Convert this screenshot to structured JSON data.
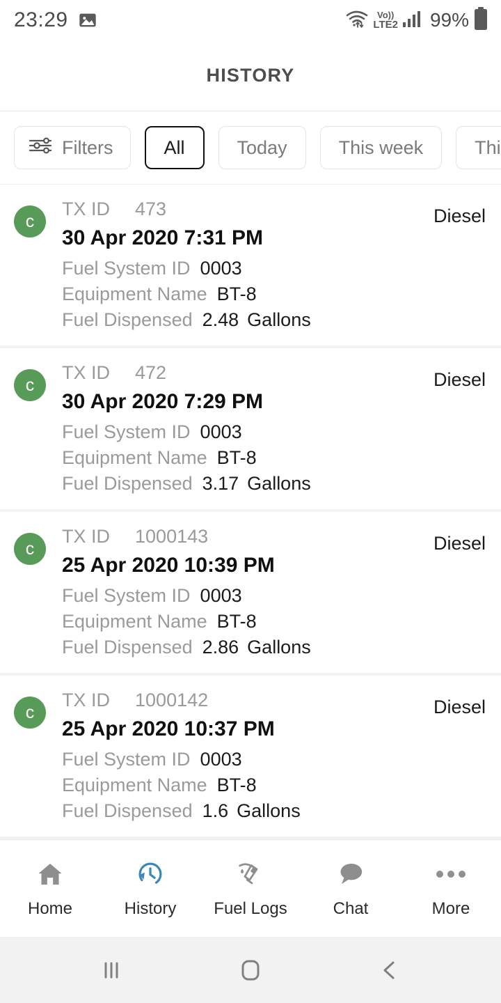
{
  "status_bar": {
    "clock": "23:29",
    "left_icon": "image-icon",
    "network_label_top": "Vo))",
    "network_label": "LTE2",
    "battery_percent": "99%",
    "icons": [
      "image-icon",
      "wifi-icon",
      "volte-icon",
      "signal-icon",
      "battery-icon"
    ]
  },
  "header": {
    "title": "HISTORY"
  },
  "filters": {
    "filters_label": "Filters",
    "filter_icon": "sliders-icon",
    "chips": [
      {
        "label": "All",
        "selected": true
      },
      {
        "label": "Today",
        "selected": false
      },
      {
        "label": "This week",
        "selected": false
      },
      {
        "label": "This month",
        "selected": false
      }
    ]
  },
  "labels": {
    "tx_id": "TX ID",
    "fuel_system_id": "Fuel System ID",
    "equipment_name": "Equipment Name",
    "fuel_dispensed": "Fuel Dispensed",
    "unit": "Gallons"
  },
  "transactions": [
    {
      "avatar": "c",
      "tx_id": "473",
      "datetime": "30 Apr 2020 7:31 PM",
      "fuel_system_id": "0003",
      "equipment_name": "BT-8",
      "fuel_dispensed": "2.48",
      "unit": "Gallons",
      "fuel_type": "Diesel"
    },
    {
      "avatar": "c",
      "tx_id": "472",
      "datetime": "30 Apr 2020 7:29 PM",
      "fuel_system_id": "0003",
      "equipment_name": "BT-8",
      "fuel_dispensed": "3.17",
      "unit": "Gallons",
      "fuel_type": "Diesel"
    },
    {
      "avatar": "c",
      "tx_id": "1000143",
      "datetime": "25 Apr 2020 10:39 PM",
      "fuel_system_id": "0003",
      "equipment_name": "BT-8",
      "fuel_dispensed": "2.86",
      "unit": "Gallons",
      "fuel_type": "Diesel"
    },
    {
      "avatar": "c",
      "tx_id": "1000142",
      "datetime": "25 Apr 2020 10:37 PM",
      "fuel_system_id": "0003",
      "equipment_name": "BT-8",
      "fuel_dispensed": "1.6",
      "unit": "Gallons",
      "fuel_type": "Diesel"
    }
  ],
  "tabbar": {
    "active": "History",
    "accent_color": "#3a87b8",
    "inactive_color": "#8e8e8e",
    "items": [
      {
        "label": "Home",
        "icon": "home-icon",
        "active": false
      },
      {
        "label": "History",
        "icon": "history-clock-icon",
        "active": true
      },
      {
        "label": "Fuel Logs",
        "icon": "fuel-nozzle-icon",
        "active": false
      },
      {
        "label": "Chat",
        "icon": "chat-bubble-icon",
        "active": false
      },
      {
        "label": "More",
        "icon": "ellipsis-icon",
        "active": false
      }
    ]
  },
  "android_nav": {
    "recents": "recents-icon",
    "home": "home-square-icon",
    "back": "back-chevron-icon"
  },
  "colors": {
    "avatar_green": "#589b58",
    "accent_blue": "#3a87b8",
    "label_gray": "#9a9a9a",
    "value_dark": "#1b1b1b"
  }
}
